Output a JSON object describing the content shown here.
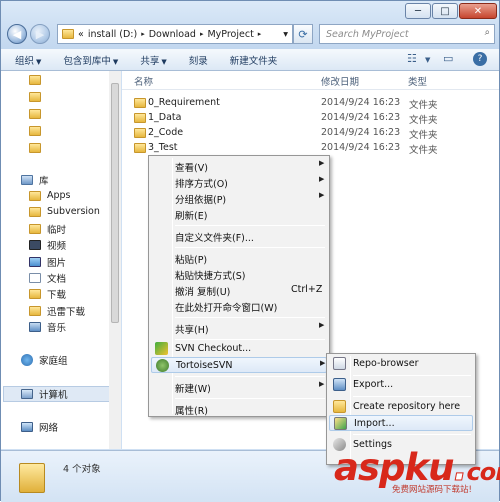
{
  "window": {
    "minimize": "─",
    "maximize": "□",
    "close": "✕"
  },
  "address": {
    "separator": "«",
    "crumbs": [
      "install (D:)",
      "Download",
      "MyProject"
    ],
    "sep": "▸",
    "dropdown": "▾"
  },
  "search": {
    "placeholder": "Search MyProject"
  },
  "toolbar": {
    "organize": "组织",
    "include_library": "包含到库中",
    "share": "共享",
    "burn": "刻录",
    "new_folder": "新建文件夹"
  },
  "nav": {
    "library": "库",
    "items": [
      "Apps",
      "Subversion",
      "临时",
      "视频",
      "图片",
      "文档",
      "下载",
      "迅雷下载",
      "音乐"
    ],
    "homegroup": "家庭组",
    "computer": "计算机",
    "network": "网络"
  },
  "columns": {
    "name": "名称",
    "date": "修改日期",
    "type": "类型"
  },
  "files": [
    {
      "name": "0_Requirement",
      "date": "2014/9/24 16:23",
      "type": "文件夹"
    },
    {
      "name": "1_Data",
      "date": "2014/9/24 16:23",
      "type": "文件夹"
    },
    {
      "name": "2_Code",
      "date": "2014/9/24 16:23",
      "type": "文件夹"
    },
    {
      "name": "3_Test",
      "date": "2014/9/24 16:23",
      "type": "文件夹"
    }
  ],
  "status": {
    "count": "4 个对象"
  },
  "context_menu": {
    "view": "查看(V)",
    "sort": "排序方式(O)",
    "group": "分组依据(P)",
    "refresh": "刷新(E)",
    "customize": "自定义文件夹(F)...",
    "paste": "粘贴(P)",
    "paste_shortcut": "粘贴快捷方式(S)",
    "undo": "撤消 复制(U)",
    "undo_shortcut": "Ctrl+Z",
    "cmd_here": "在此处打开命令窗口(W)",
    "share": "共享(H)",
    "svn_checkout": "SVN Checkout...",
    "tortoise": "TortoiseSVN",
    "new": "新建(W)",
    "properties": "属性(R)"
  },
  "submenu": {
    "repo_browser": "Repo-browser",
    "export": "Export...",
    "create_repo": "Create repository here",
    "import": "Import...",
    "settings": "Settings"
  },
  "watermark": {
    "brand": "aspku",
    "tld": "com",
    "slogan": "免费网站源码下载站!"
  },
  "colors": {
    "accent": "#3a6ea5",
    "highlight": "#dde9f7",
    "folder": "#e6b73e",
    "watermark": "#d8281b"
  }
}
